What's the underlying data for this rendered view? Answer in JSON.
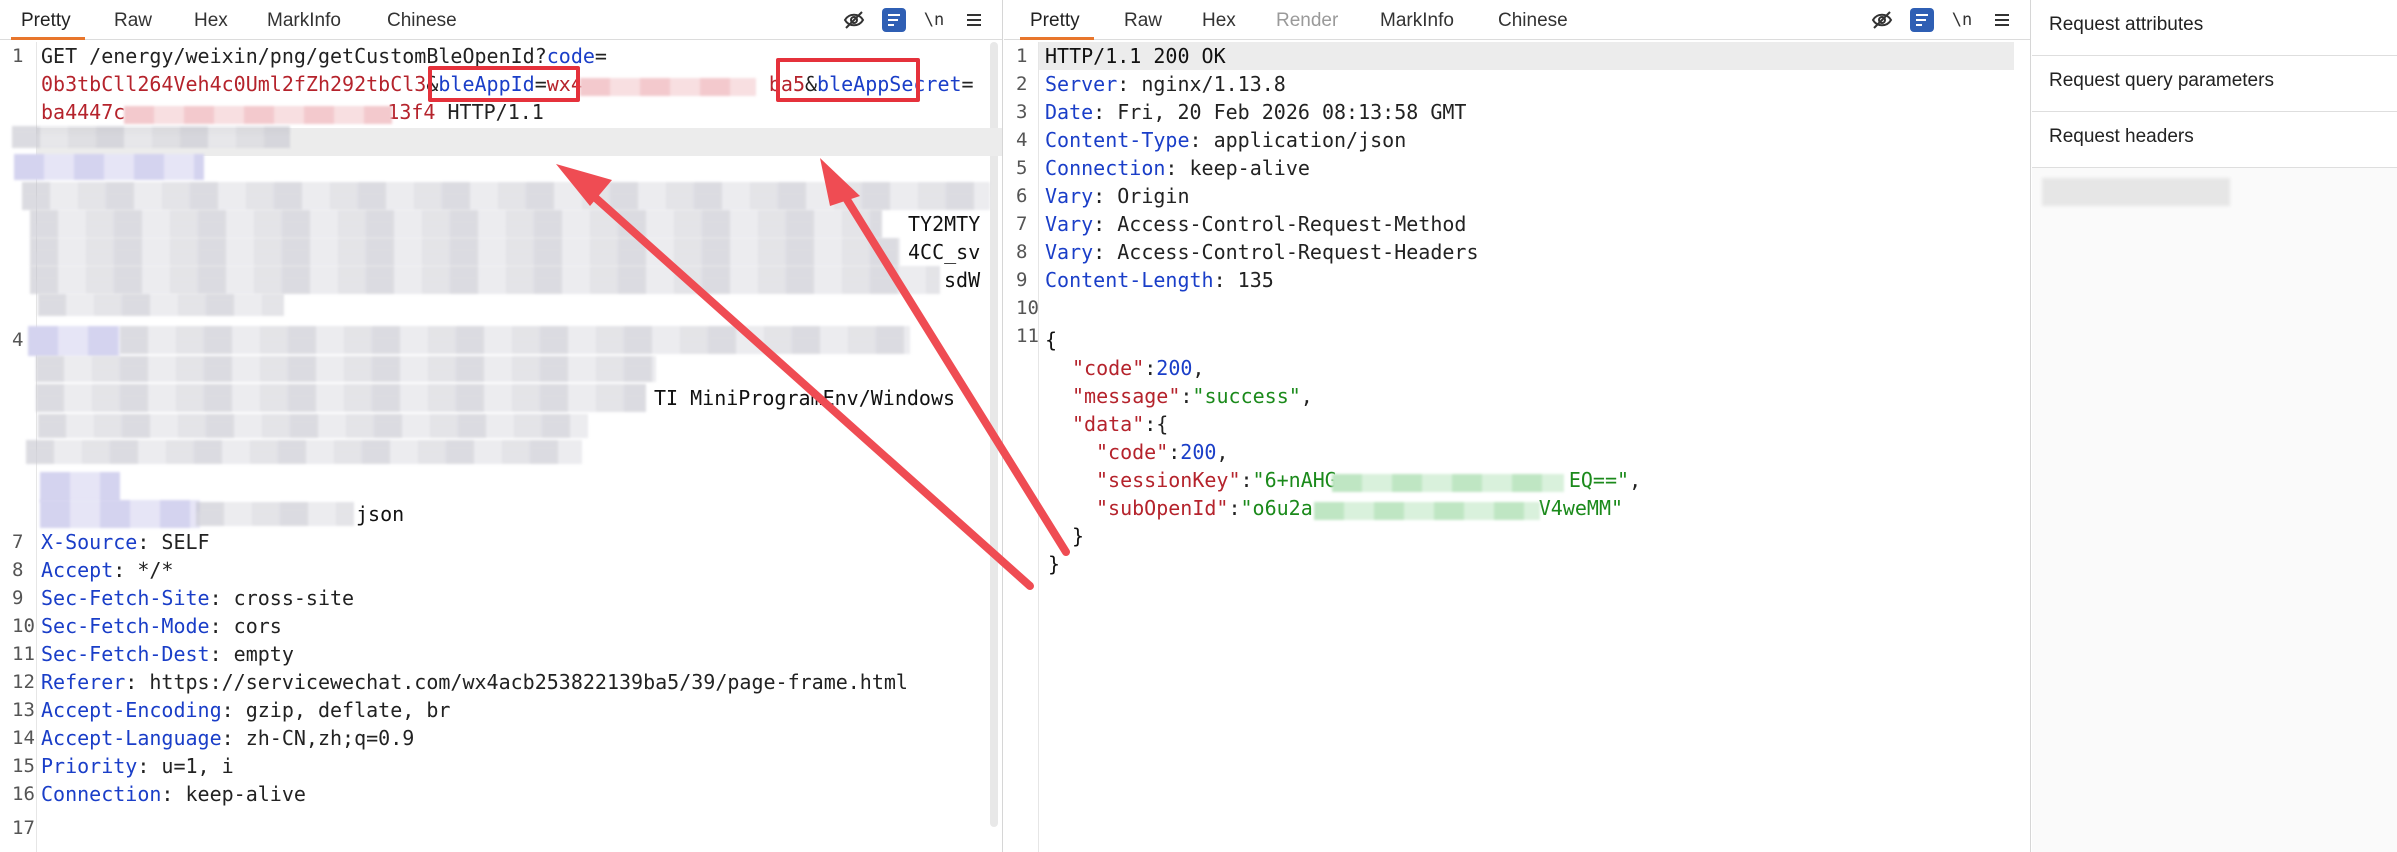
{
  "request": {
    "tabs": [
      "Pretty",
      "Raw",
      "Hex",
      "MarkInfo",
      "Chinese"
    ],
    "active_tab": "Pretty",
    "line1_a_method": "GET ",
    "line1_a_path": "/energy/weixin/png/getCustomBleOpenId?",
    "line1_a_param": "code",
    "line1_a_eq": "=",
    "line1_b_val": "0b3tbCll264Veh4c0Uml2fZh292tbCl3",
    "line1_b_amp": "&",
    "line1_b_param": "bleAppId",
    "line1_b_eq": "=",
    "line1_b_val2": "wx4",
    "line1_b_val3": "ba5",
    "line1_b_amp2": "&",
    "line1_b_param2": "bleAppSecret",
    "line1_b_eq2": "=",
    "line1_c_val": "ba4447c",
    "line1_c_val2": "13f4",
    "line1_c_proto": " HTTP/1.1",
    "frag_ty2mty": "TY2MTY",
    "frag_4cc_sv": "4CC_sv",
    "frag_sdw": "sdW",
    "frag_ua": "TI MiniProgramEnv/Windows",
    "frag_json": "json",
    "headers": [
      {
        "n": "7",
        "k": "X-Source",
        "v": "SELF"
      },
      {
        "n": "8",
        "k": "Accept",
        "v": "*/*"
      },
      {
        "n": "9",
        "k": "Sec-Fetch-Site",
        "v": "cross-site"
      },
      {
        "n": "10",
        "k": "Sec-Fetch-Mode",
        "v": "cors"
      },
      {
        "n": "11",
        "k": "Sec-Fetch-Dest",
        "v": "empty"
      },
      {
        "n": "12",
        "k": "Referer",
        "v": "https://servicewechat.com/wx4acb253822139ba5/39/page-frame.html"
      },
      {
        "n": "13",
        "k": "Accept-Encoding",
        "v": "gzip, deflate, br"
      },
      {
        "n": "14",
        "k": "Accept-Language",
        "v": "zh-CN,zh;q=0.9"
      },
      {
        "n": "15",
        "k": "Priority",
        "v": "u=1, i"
      },
      {
        "n": "16",
        "k": "Connection",
        "v": "keep-alive"
      }
    ],
    "line_numbers_top": [
      "1",
      "4"
    ],
    "last_line_number": "17",
    "separator": ": "
  },
  "response": {
    "tabs": [
      "Pretty",
      "Raw",
      "Hex",
      "Render",
      "MarkInfo",
      "Chinese"
    ],
    "active_tab": "Pretty",
    "disabled_tab": "Render",
    "status_line": "HTTP/1.1 200 OK",
    "headers": [
      {
        "n": "2",
        "k": "Server",
        "v": "nginx/1.13.8"
      },
      {
        "n": "3",
        "k": "Date",
        "v": "Fri, 20 Feb 2026 08:13:58 GMT"
      },
      {
        "n": "4",
        "k": "Content-Type",
        "v": "application/json"
      },
      {
        "n": "5",
        "k": "Connection",
        "v": "keep-alive"
      },
      {
        "n": "6",
        "k": "Vary",
        "v": "Origin"
      },
      {
        "n": "7",
        "k": "Vary",
        "v": "Access-Control-Request-Method"
      },
      {
        "n": "8",
        "k": "Vary",
        "v": "Access-Control-Request-Headers"
      },
      {
        "n": "9",
        "k": "Content-Length",
        "v": "135"
      }
    ],
    "separator": ": ",
    "ln1": "1",
    "ln10": "10",
    "ln11": "11",
    "body": {
      "open_brace": "{",
      "close_brace": "}",
      "inner_close": "}",
      "code_key": "\"code\"",
      "code_val": "200",
      "message_key": "\"message\"",
      "message_val": "\"success\"",
      "data_key": "\"data\"",
      "data_open": "{",
      "inner_code_key": "\"code\"",
      "inner_code_val": "200",
      "session_key": "\"sessionKey\"",
      "session_val_a": "\"6+nAHG",
      "session_val_b": "EQ==\"",
      "subopen_key": "\"subOpenId\"",
      "subopen_val_a": "\"o6u2a",
      "subopen_val_b": "V4weMM\"",
      "colon": ":",
      "comma": ","
    }
  },
  "inspector": {
    "items": [
      "Request attributes",
      "Request query parameters",
      "Request headers"
    ]
  },
  "icons": {
    "hide": "eye-slash-icon",
    "wrap": "text-wrap-icon",
    "newline": "\\n",
    "menu": "menu-icon"
  },
  "colors": {
    "accent_tab": "#e8762c",
    "key_blue": "#1a3ec8",
    "value_red": "#b5232c",
    "string_green": "#1b8a1b",
    "annotation_red": "#e5313b"
  }
}
